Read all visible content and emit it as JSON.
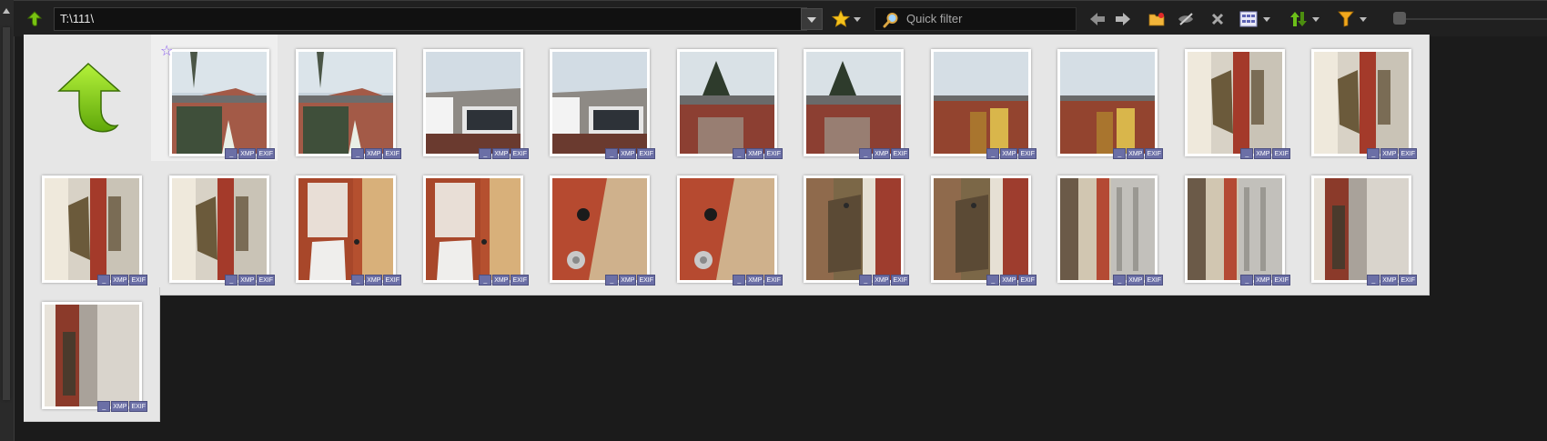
{
  "toolbar": {
    "path": "T:\\111\\",
    "filter_placeholder": "Quick filter"
  },
  "badges": {
    "dash": "_",
    "xmp": "XMP",
    "exif": "EXIF"
  },
  "photos": [
    {
      "scene": "house-sky"
    },
    {
      "scene": "house-sky"
    },
    {
      "scene": "house-window"
    },
    {
      "scene": "house-window"
    },
    {
      "scene": "brick-tree"
    },
    {
      "scene": "brick-tree"
    },
    {
      "scene": "brick-door"
    },
    {
      "scene": "brick-door"
    },
    {
      "scene": "hinge"
    },
    {
      "scene": "hinge"
    },
    {
      "scene": "hinge"
    },
    {
      "scene": "hinge"
    },
    {
      "scene": "door-red"
    },
    {
      "scene": "door-red"
    },
    {
      "scene": "knob"
    },
    {
      "scene": "knob"
    },
    {
      "scene": "latch"
    },
    {
      "scene": "latch"
    },
    {
      "scene": "jamb"
    },
    {
      "scene": "jamb"
    },
    {
      "scene": "jamb-dark"
    },
    {
      "scene": "jamb-dark"
    }
  ],
  "colors": {
    "star": "#8a5cf0",
    "badge": "#6b6fa6",
    "arrow": "#7ac70b"
  }
}
